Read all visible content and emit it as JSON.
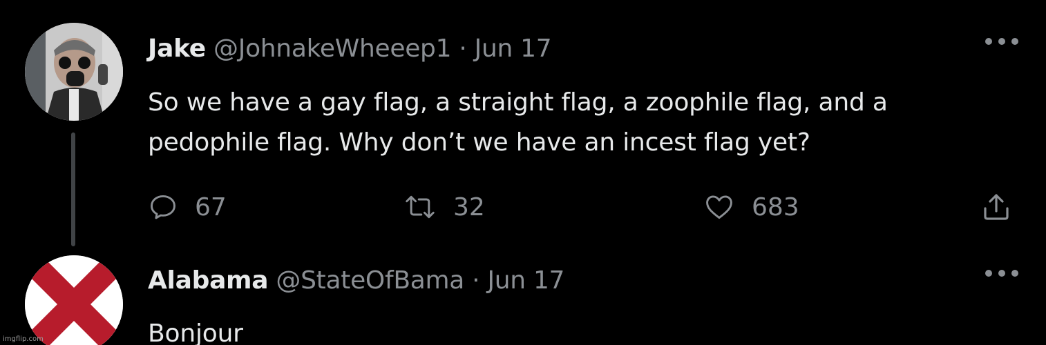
{
  "tweets": [
    {
      "name": "Jake",
      "handle": "@JohnakeWheeep1",
      "separator": " · ",
      "date": "Jun 17",
      "text": "So we have a gay flag, a straight flag, a zoophile flag, and a\npedophile flag.  Why don’t we have an incest flag yet?",
      "replies": "67",
      "retweets": "32",
      "likes": "683"
    },
    {
      "name": "Alabama",
      "handle": "@StateOfBama",
      "separator": " · ",
      "date": "Jun 17",
      "text": "Bonjour"
    }
  ],
  "icons": {
    "more": "more-horizontal-icon",
    "reply": "reply-icon",
    "retweet": "retweet-icon",
    "like": "heart-icon",
    "share": "share-icon"
  },
  "colors": {
    "background": "#000000",
    "text": "#e7e9ea",
    "secondary": "#8b8f94",
    "alabama_red": "#b71c2c"
  },
  "watermark": "imgflip.com"
}
